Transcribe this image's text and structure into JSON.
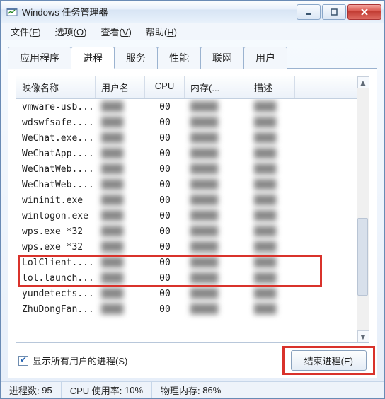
{
  "window": {
    "title": "Windows 任务管理器"
  },
  "menus": [
    {
      "label": "文件",
      "accel": "F"
    },
    {
      "label": "选项",
      "accel": "O"
    },
    {
      "label": "查看",
      "accel": "V"
    },
    {
      "label": "帮助",
      "accel": "H"
    }
  ],
  "tabs": [
    {
      "label": "应用程序"
    },
    {
      "label": "进程"
    },
    {
      "label": "服务"
    },
    {
      "label": "性能"
    },
    {
      "label": "联网"
    },
    {
      "label": "用户"
    }
  ],
  "active_tab": 1,
  "columns": {
    "image": "映像名称",
    "user": "用户名",
    "cpu": "CPU",
    "mem": "内存(...",
    "desc": "描述"
  },
  "processes": [
    {
      "img": "vmware-usb...",
      "cpu": "00"
    },
    {
      "img": "wdswfsafe....",
      "cpu": "00"
    },
    {
      "img": "WeChat.exe...",
      "cpu": "00"
    },
    {
      "img": "WeChatApp....",
      "cpu": "00"
    },
    {
      "img": "WeChatWeb....",
      "cpu": "00"
    },
    {
      "img": "WeChatWeb....",
      "cpu": "00"
    },
    {
      "img": "wininit.exe",
      "cpu": "00"
    },
    {
      "img": "winlogon.exe",
      "cpu": "00"
    },
    {
      "img": "wps.exe *32",
      "cpu": "00"
    },
    {
      "img": "wps.exe *32",
      "cpu": "00"
    },
    {
      "img": "LolClient....",
      "cpu": "00"
    },
    {
      "img": "lol.launch...",
      "cpu": "00"
    },
    {
      "img": "yundetects...",
      "cpu": "00"
    },
    {
      "img": "ZhuDongFan...",
      "cpu": "00"
    }
  ],
  "checkbox_label": "显示所有用户的进程(S)",
  "checkbox_checked": true,
  "end_process_label": "结束进程(E)",
  "status": {
    "processes_label": "进程数:",
    "processes_value": "95",
    "cpu_label": "CPU 使用率:",
    "cpu_value": "10%",
    "mem_label": "物理内存:",
    "mem_value": "86%"
  }
}
